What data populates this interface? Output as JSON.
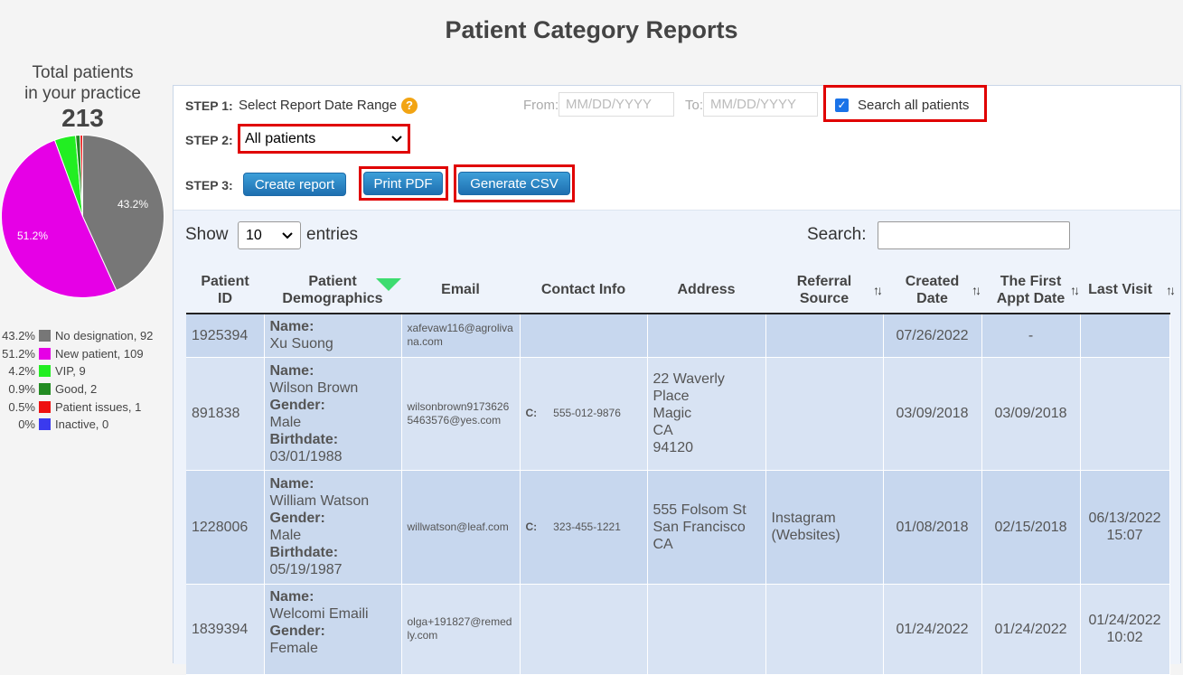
{
  "page": {
    "title": "Patient Category Reports"
  },
  "summary": {
    "caption_line1": "Total patients",
    "caption_line2": "in your practice",
    "total": "213",
    "pie_labels": {
      "no_designation": "43.2%",
      "new_patient": "51.2%"
    },
    "legend": [
      {
        "pct": "43.2%",
        "label": "No designation, 92",
        "color": "#777777"
      },
      {
        "pct": "51.2%",
        "label": "New patient, 109",
        "color": "#e600e6"
      },
      {
        "pct": "4.2%",
        "label": "VIP, 9",
        "color": "#22ee22"
      },
      {
        "pct": "0.9%",
        "label": "Good, 2",
        "color": "#228b22"
      },
      {
        "pct": "0.5%",
        "label": "Patient issues, 1",
        "color": "#ee1111"
      },
      {
        "pct": "0%",
        "label": "Inactive, 0",
        "color": "#3a3aee"
      }
    ]
  },
  "steps": {
    "step1_label": "STEP 1:",
    "step1_text": "Select Report Date Range",
    "help_icon": "?",
    "from_label": "From:",
    "from_placeholder": "MM/DD/YYYY",
    "to_label": "To:",
    "to_placeholder": "MM/DD/YYYY",
    "search_all_label": "Search all patients",
    "search_all_checked": true,
    "step2_label": "STEP 2:",
    "category_selected": "All patients",
    "step3_label": "STEP 3:",
    "create_report": "Create report",
    "print_pdf": "Print PDF",
    "generate_csv": "Generate CSV"
  },
  "table_controls": {
    "show_label": "Show",
    "entries_value": "10",
    "entries_label": "entries",
    "search_label": "Search:"
  },
  "columns": {
    "patient_id": [
      "Patient",
      "ID"
    ],
    "demographics": [
      "Patient",
      "Demographics"
    ],
    "email": "Email",
    "contact": "Contact Info",
    "address": "Address",
    "referral": [
      "Referral",
      "Source"
    ],
    "created": [
      "Created",
      "Date"
    ],
    "first_appt": [
      "The First",
      "Appt Date"
    ],
    "last_visit": "Last Visit"
  },
  "field_labels": {
    "name": "Name:",
    "gender": "Gender:",
    "birthdate": "Birthdate:",
    "cell": "C:"
  },
  "rows": [
    {
      "id": "1925394",
      "name": "Xu Suong",
      "gender": "",
      "birthdate": "",
      "email": "xafevaw116@agrolivana.com",
      "phone": "",
      "address": [],
      "referral": [],
      "created": "07/26/2022",
      "first_appt": "-",
      "last_visit": []
    },
    {
      "id": "891838",
      "name": "Wilson Brown",
      "gender": "Male",
      "birthdate": "03/01/1988",
      "email": "wilsonbrown91736265463576@yes.com",
      "phone": "555-012-9876",
      "address": [
        "22 Waverly",
        "Place",
        "Magic",
        "CA",
        "94120"
      ],
      "referral": [],
      "created": "03/09/2018",
      "first_appt": "03/09/2018",
      "last_visit": []
    },
    {
      "id": "1228006",
      "name": "William Watson",
      "gender": "Male",
      "birthdate": "05/19/1987",
      "email": "willwatson@leaf.com",
      "phone": "323-455-1221",
      "address": [
        "555 Folsom St",
        "San Francisco",
        "CA"
      ],
      "referral": [
        "Instagram",
        "(Websites)"
      ],
      "created": "01/08/2018",
      "first_appt": "02/15/2018",
      "last_visit": [
        "06/13/2022",
        "15:07"
      ]
    },
    {
      "id": "1839394",
      "name": "Welcomi Emaili",
      "gender": "Female",
      "birthdate": "",
      "email": "olga+191827@remedly.com",
      "phone": "",
      "address": [],
      "referral": [],
      "created": "01/24/2022",
      "first_appt": "01/24/2022",
      "last_visit": [
        "01/24/2022",
        "10:02"
      ]
    }
  ]
}
